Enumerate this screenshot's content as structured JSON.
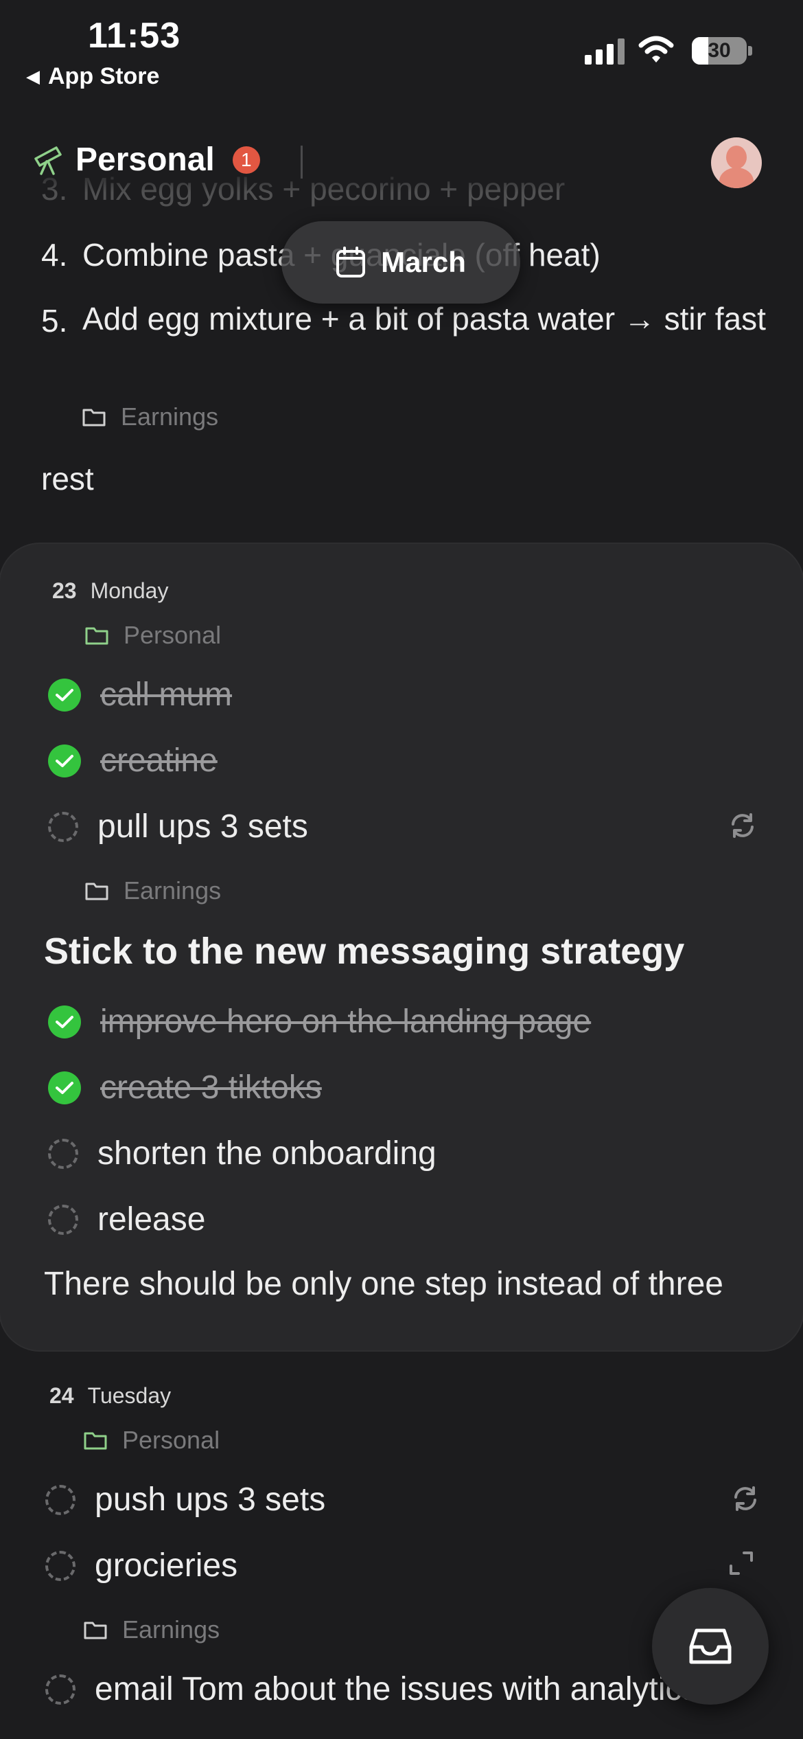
{
  "status_bar": {
    "time": "11:53",
    "back_label": "App Store",
    "battery_level": "30"
  },
  "header": {
    "title": "Personal",
    "badge_count": "1"
  },
  "month_pill": {
    "label": "March"
  },
  "top_list": {
    "items": [
      {
        "num": "3.",
        "text": "Mix egg yolks + pecorino + pepper"
      },
      {
        "num": "4.",
        "text": "Combine pasta + guanciale (off heat)"
      },
      {
        "num": "5.",
        "text": "Add egg mixture + a bit of pasta water → stir fast"
      }
    ],
    "folder": "Earnings",
    "trailing_text": "rest"
  },
  "day_23": {
    "day": "23",
    "weekday": "Monday",
    "personal_folder": "Personal",
    "personal_tasks": [
      {
        "text": "call mum",
        "done": true
      },
      {
        "text": "creatine",
        "done": true
      },
      {
        "text": "pull ups 3 sets",
        "done": false
      }
    ],
    "earnings_folder": "Earnings",
    "goal_heading": "Stick to the new messaging strategy",
    "earnings_tasks": [
      {
        "text": "improve hero on the landing page",
        "done": true
      },
      {
        "text": "create 3 tiktoks",
        "done": true
      },
      {
        "text": "shorten the onboarding",
        "done": false
      },
      {
        "text": "release",
        "done": false
      }
    ],
    "note": "There should be only one step instead of three"
  },
  "day_24": {
    "day": "24",
    "weekday": "Tuesday",
    "personal_folder": "Personal",
    "personal_tasks": [
      {
        "text": "push ups 3 sets",
        "done": false
      },
      {
        "text": "grocieries",
        "done": false
      }
    ],
    "earnings_folder": "Earnings",
    "earnings_tasks": [
      {
        "text": "email Tom about the issues with analytics",
        "done": false
      }
    ]
  },
  "colors": {
    "background": "#1c1c1e",
    "card": "#28282a",
    "check_green": "#34c43e",
    "badge_red": "#e25742",
    "folder_green": "#8fd18a"
  },
  "icons": [
    "telescope-icon",
    "calendar-icon",
    "folder-icon",
    "check-icon",
    "repeat-icon",
    "expand-icon",
    "inbox-icon"
  ]
}
